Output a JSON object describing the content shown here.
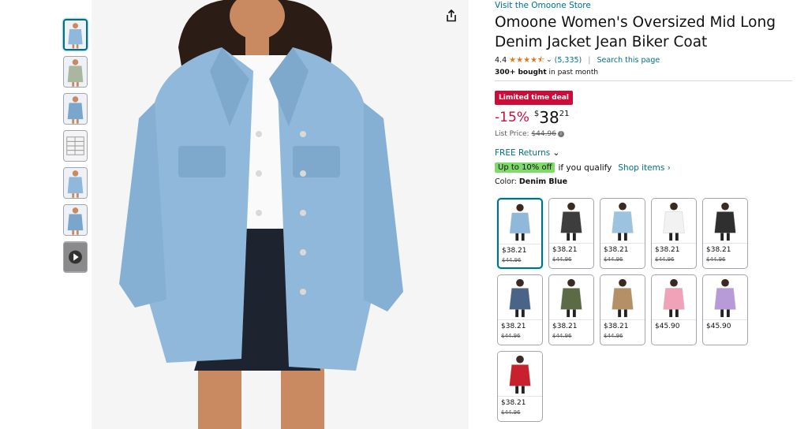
{
  "store_link": "Visit the Omoone Store",
  "title": "Omoone Women's Oversized Mid Long Denim Jacket Jean Biker Coat",
  "rating": {
    "value": "4.4",
    "stars": 4.4,
    "count": "(5,335)",
    "search_link": "Search this page"
  },
  "bought": {
    "bold": "300+ bought",
    "rest": " in past month"
  },
  "deal_badge": "Limited time deal",
  "price": {
    "discount": "-15%",
    "currency": "$",
    "whole": "38",
    "fraction": "21",
    "list_label": "List Price: ",
    "list_value": "$44.96"
  },
  "returns": "FREE Returns",
  "promo": {
    "badge": "Up to 10% off",
    "qualify": "if you qualify",
    "shop": "Shop items ›"
  },
  "color": {
    "label": "Color: ",
    "value": "Denim Blue"
  },
  "swatches": [
    {
      "price": "$38.21",
      "list": "$44.96",
      "jacket": "#8fb8da",
      "selected": true
    },
    {
      "price": "$38.21",
      "list": "$44.96",
      "jacket": "#3d3d3d"
    },
    {
      "price": "$38.21",
      "list": "$44.96",
      "jacket": "#9cc3e0"
    },
    {
      "price": "$38.21",
      "list": "$44.96",
      "jacket": "#f2f2f2"
    },
    {
      "price": "$38.21",
      "list": "$44.96",
      "jacket": "#2f2f2f"
    },
    {
      "price": "$38.21",
      "list": "$44.96",
      "jacket": "#4a6488"
    },
    {
      "price": "$38.21",
      "list": "$44.96",
      "jacket": "#5b6b45"
    },
    {
      "price": "$38.21",
      "list": "$44.96",
      "jacket": "#b59066"
    },
    {
      "price": "$45.90",
      "list": "",
      "jacket": "#f0a2b8"
    },
    {
      "price": "$45.90",
      "list": "",
      "jacket": "#b79ad8"
    },
    {
      "price": "$38.21",
      "list": "$44.96",
      "jacket": "#c8202c"
    }
  ],
  "thumbnails": [
    {
      "icon": "product-photo-thumbnail",
      "tone": "#8fb8da"
    },
    {
      "icon": "product-photo-thumbnail",
      "tone": "#a9b6a0"
    },
    {
      "icon": "product-photo-thumbnail",
      "tone": "#7aa6cc"
    },
    {
      "icon": "size-chart-thumbnail",
      "tone": "#dcdcdc"
    },
    {
      "icon": "product-photo-thumbnail",
      "tone": "#8fb8da"
    },
    {
      "icon": "product-photo-thumbnail",
      "tone": "#7aa6cc"
    },
    {
      "icon": "video-play-thumbnail",
      "tone": "#555555"
    }
  ],
  "colors": {
    "link": "#007185",
    "deal": "#cc0c39",
    "star": "#de7921",
    "promo": "#7fda69"
  }
}
